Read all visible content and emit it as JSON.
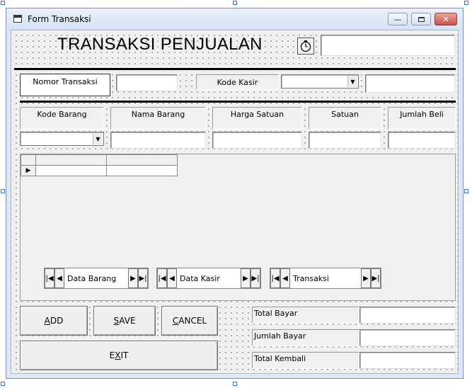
{
  "window": {
    "title": "Form Transaksi",
    "min_glyph": "—",
    "max_glyph": "▫",
    "close_glyph": "✕"
  },
  "header": {
    "title": "TRANSAKSI PENJUALAN",
    "timer_icon": "stopwatch-icon",
    "datetime_value": ""
  },
  "transaction": {
    "nomor_label": "Nomor Transaksi",
    "nomor_value": "",
    "kasir_label": "Kode Kasir",
    "kasir_selected": "",
    "kasir_name_value": ""
  },
  "item_fields": {
    "kode_barang_label": "Kode Barang",
    "nama_barang_label": "Nama Barang",
    "harga_label": "Harga Satuan",
    "satuan_label": "Satuan",
    "jumlah_label": "Jumlah Beli",
    "kode_barang_selected": "",
    "nama_barang_value": "",
    "harga_value": "",
    "satuan_value": "",
    "jumlah_value": ""
  },
  "datagrid": {
    "row_marker": "▶"
  },
  "navigators": [
    {
      "caption": "Data Barang"
    },
    {
      "caption": "Data Kasir"
    },
    {
      "caption": "Transaksi"
    }
  ],
  "nav_glyphs": {
    "first": "|◀",
    "prev": "◀",
    "next": "▶",
    "last": "▶|"
  },
  "buttons": {
    "add_prefix": "",
    "add_hotkey": "A",
    "add_rest": "DD",
    "save_hotkey": "S",
    "save_rest": "AVE",
    "cancel_hotkey": "C",
    "cancel_rest": "ANCEL",
    "exit_prefix": "E",
    "exit_hotkey": "X",
    "exit_rest": "IT"
  },
  "summary": {
    "total_bayar_label": "Total Bayar",
    "jumlah_bayar_label": "Jumlah Bayar",
    "total_kembali_label": "Total Kembali",
    "total_bayar_value": "",
    "jumlah_bayar_value": "",
    "total_kembali_value": ""
  },
  "colors": {
    "accent": "#2f78c7",
    "close_button": "#c75050",
    "form_background": "#f0f0f0"
  }
}
